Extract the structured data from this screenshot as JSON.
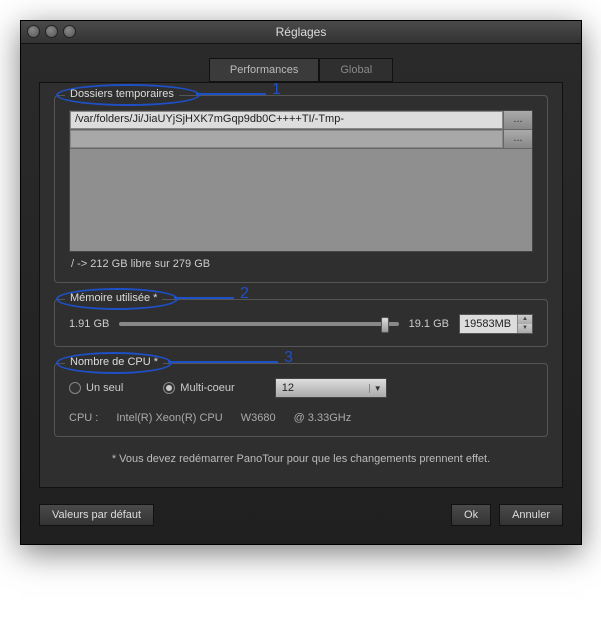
{
  "window": {
    "title": "Réglages"
  },
  "tabs": {
    "performances": "Performances",
    "global": "Global"
  },
  "folders": {
    "title": "Dossiers temporaires",
    "rows": [
      {
        "path": "/var/folders/Ji/JiaUYjSjHXK7mGqp9db0C++++TI/-Tmp-",
        "browse": "..."
      },
      {
        "path": "",
        "browse": "..."
      }
    ],
    "free_space": "/ -> 212 GB libre sur 279 GB"
  },
  "memory": {
    "title": "Mémoire utilisée *",
    "min_label": "1.91 GB",
    "max_label": "19.1 GB",
    "value": "19583MB"
  },
  "cpu": {
    "title": "Nombre de CPU *",
    "single_label": "Un seul",
    "multi_label": "Multi-coeur",
    "selected_count": "12",
    "info_label": "CPU :",
    "info_model": "Intel(R) Xeon(R) CPU",
    "info_number": "W3680",
    "info_clock": "@ 3.33GHz"
  },
  "note": "* Vous devez redémarrer PanoTour pour que les changements prennent effet.",
  "buttons": {
    "defaults": "Valeurs par défaut",
    "ok": "Ok",
    "cancel": "Annuler"
  },
  "annotations": {
    "n1": "1",
    "n2": "2",
    "n3": "3"
  }
}
